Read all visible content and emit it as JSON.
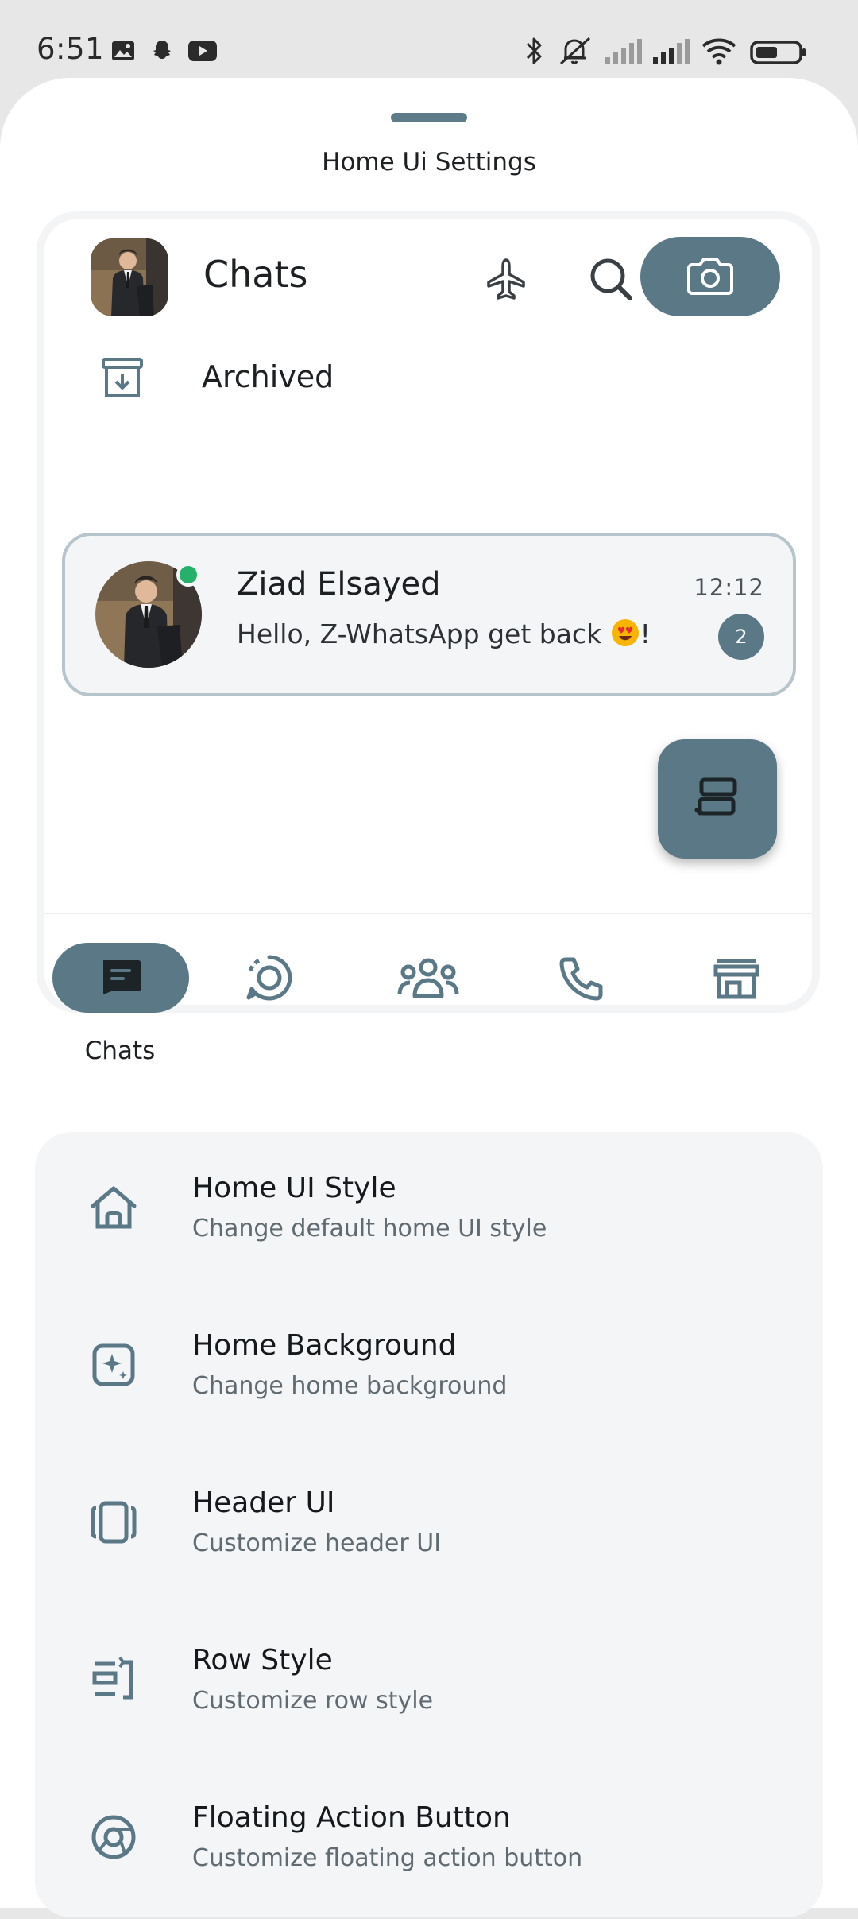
{
  "status_bar": {
    "time": "6:51",
    "left_icons": [
      "gallery-icon",
      "snapchat-icon",
      "youtube-icon"
    ],
    "right_icons": [
      "bluetooth-icon",
      "mute-icon",
      "signal-icon",
      "signal-icon",
      "wifi-icon",
      "battery-icon"
    ]
  },
  "sheet": {
    "title": "Home Ui Settings"
  },
  "preview": {
    "header_title": "Chats",
    "header_icons": [
      "airplane-icon",
      "search-icon",
      "camera-icon"
    ],
    "archived_label": "Archived",
    "chat": {
      "name": "Ziad Elsayed",
      "message_before_emoji": "Hello, Z-WhatsApp get back ",
      "message_after_emoji": "!",
      "time": "12:12",
      "unread_count": "2",
      "online": true
    },
    "bottom_nav": {
      "active_label": "Chats",
      "items": [
        "chats-icon",
        "status-icon",
        "communities-icon",
        "calls-icon",
        "store-icon"
      ]
    }
  },
  "settings": [
    {
      "title": "Home UI Style",
      "subtitle": "Change default home UI style",
      "icon": "home-icon"
    },
    {
      "title": "Home Background",
      "subtitle": "Change home background",
      "icon": "background-icon"
    },
    {
      "title": "Header UI",
      "subtitle": "Customize header UI",
      "icon": "header-icon"
    },
    {
      "title": "Row Style",
      "subtitle": "Customize row style",
      "icon": "row-icon"
    },
    {
      "title": "Floating Action Button",
      "subtitle": "Customize floating action button",
      "icon": "fab-icon"
    }
  ],
  "colors": {
    "accent": "#5b7887",
    "online": "#25b16a",
    "card_border": "#b6c4cb",
    "settings_bg": "#f4f5f7"
  }
}
